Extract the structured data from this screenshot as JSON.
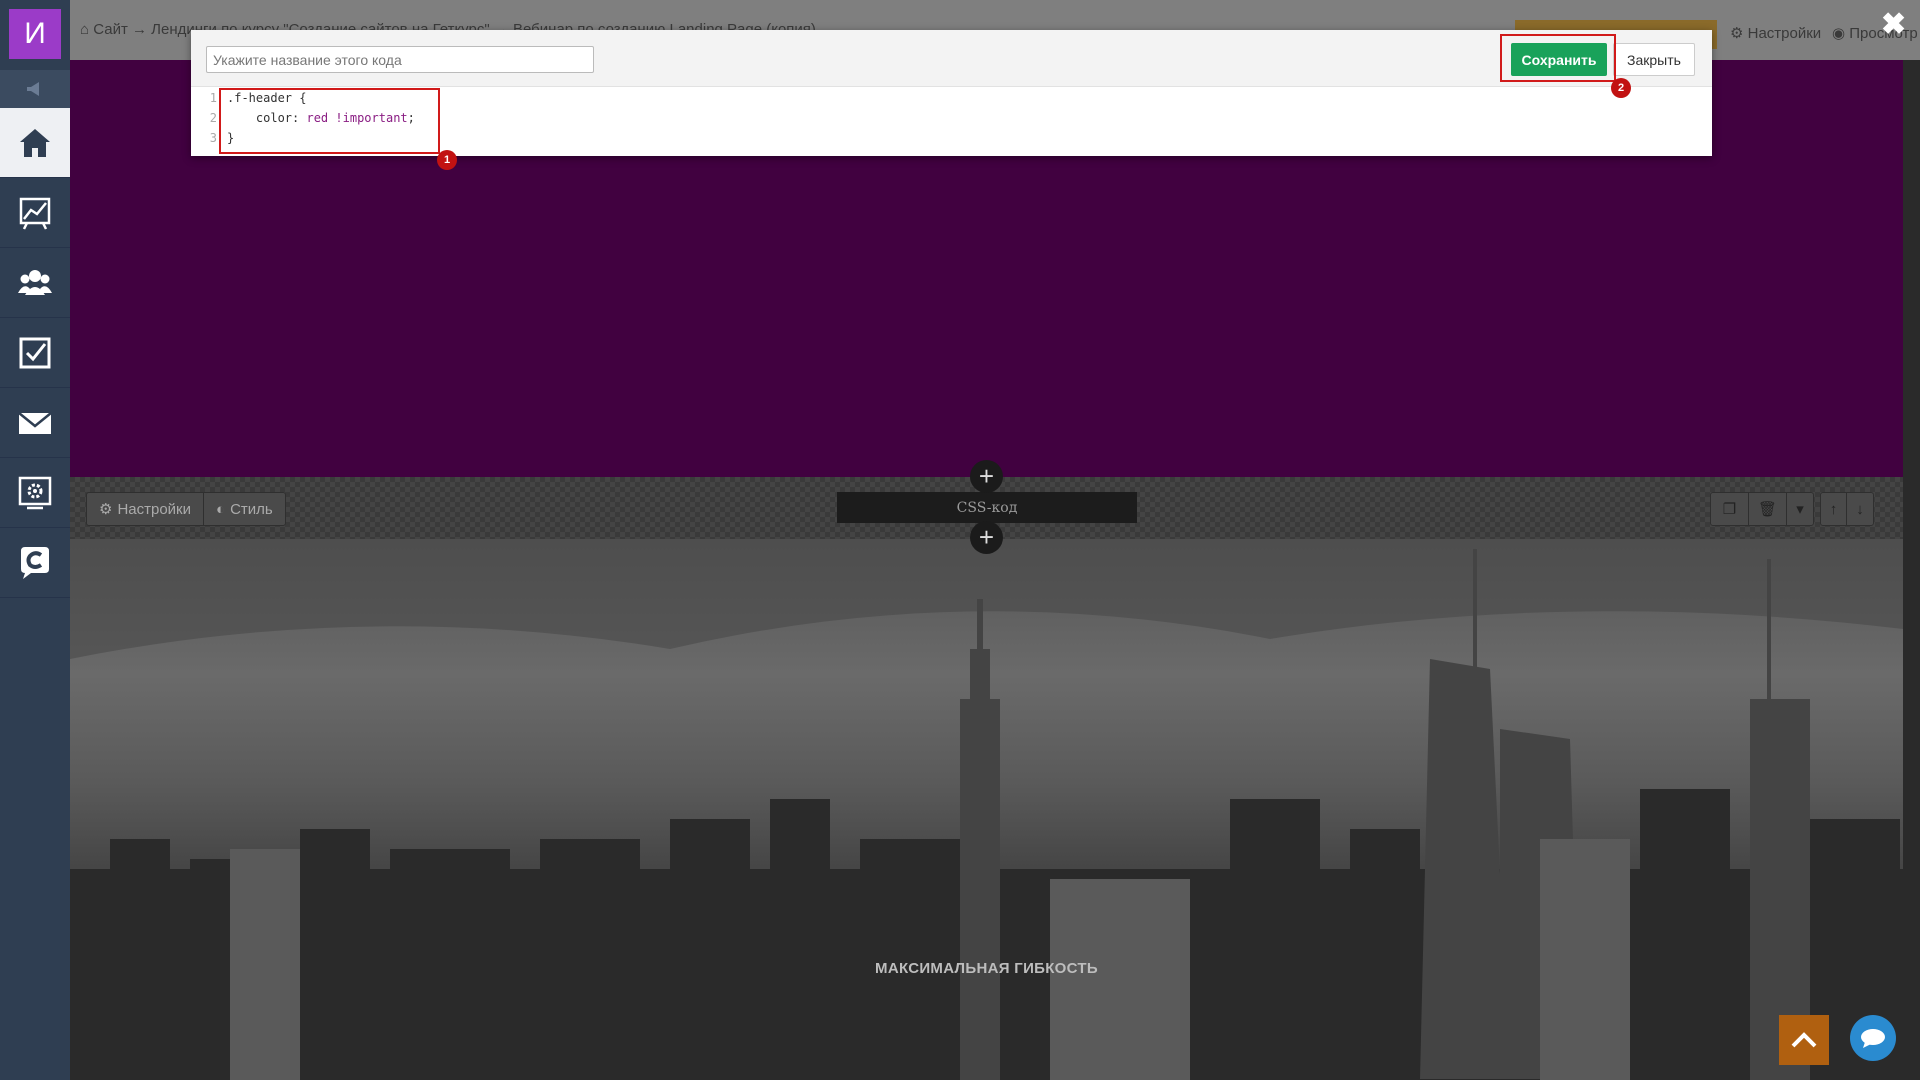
{
  "sidebar": {
    "logo_letter": "И",
    "items": [
      {
        "name": "home",
        "icon": "home-icon",
        "active": true
      },
      {
        "name": "analytics",
        "icon": "chart-icon",
        "active": false
      },
      {
        "name": "users",
        "icon": "users-icon",
        "active": false
      },
      {
        "name": "tasks",
        "icon": "checkbox-icon",
        "active": false
      },
      {
        "name": "mail",
        "icon": "envelope-icon",
        "active": false
      },
      {
        "name": "settings",
        "icon": "gear-monitor-icon",
        "active": false
      },
      {
        "name": "chat",
        "icon": "chat-c-icon",
        "active": false
      }
    ]
  },
  "topbar": {
    "breadcrumb": "Сайт → Лендинги по курсу \"Создание сайтов на Геткурс\" → Вебинар по созданию Landing Page (копия)",
    "settings_label": "Настройки",
    "preview_label": "Просмотр"
  },
  "modal": {
    "name_placeholder": "Укажите название этого кода",
    "save_label": "Сохранить",
    "close_label": "Закрыть",
    "code_lines": [
      {
        "num": "1",
        "text": ".f-header {"
      },
      {
        "num": "2",
        "prefix": "    color: ",
        "value": "red",
        "suffix_kw": " !important",
        "end": ";"
      },
      {
        "num": "3",
        "text": "}"
      }
    ]
  },
  "block_toolbar": {
    "settings_label": "Настройки",
    "style_label": "Стиль",
    "block_name": "CSS-код"
  },
  "hero": {
    "title": "МАКСИМАЛЬНАЯ ГИБКОСТЬ"
  },
  "annotations": {
    "badge1": "1",
    "badge2": "2",
    "highlight_color": "#d11a1a"
  },
  "colors": {
    "purple_section": "#410140",
    "save_green": "#19a25a",
    "sidebar": "#2f3e52",
    "logo": "#9b3bc8"
  }
}
